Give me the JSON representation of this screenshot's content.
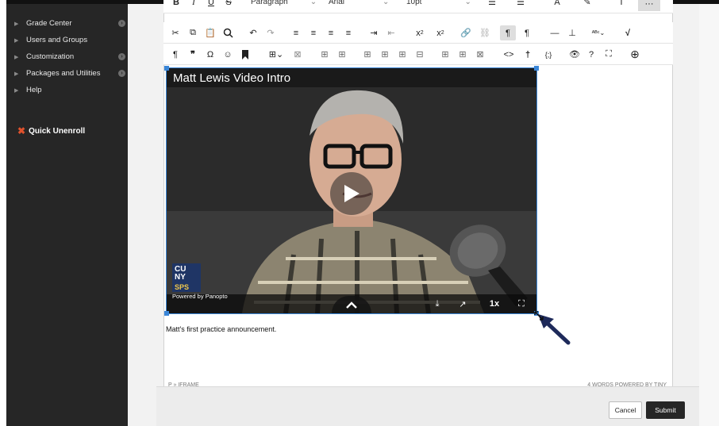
{
  "sidebar": {
    "items": [
      {
        "label": "Grade Center",
        "has_dot": true
      },
      {
        "label": "Users and Groups",
        "has_dot": false
      },
      {
        "label": "Customization",
        "has_dot": true
      },
      {
        "label": "Packages and Utilities",
        "has_dot": true
      },
      {
        "label": "Help",
        "has_dot": false
      }
    ],
    "quick_unenroll": "Quick Unenroll"
  },
  "toolbar": {
    "block_format": "Paragraph",
    "font_family": "Arial",
    "font_size": "10pt"
  },
  "video": {
    "title": "Matt Lewis Video Intro",
    "logo_lines": [
      "CU",
      "NY",
      "SPS"
    ],
    "powered_by": "Powered by Panopto",
    "speed": "1x"
  },
  "editor": {
    "body_text": "Matt's first practice announcement.",
    "path": "P » IFRAME",
    "word_count": "4 WORDS  POWERED BY TINY"
  },
  "footer": {
    "cancel_label": "Cancel",
    "submit_label": "Submit"
  },
  "colors": {
    "sidebar_bg": "#262626",
    "selection_blue": "#3a86d8",
    "arrow_navy": "#1e2a5a",
    "submit_bg": "#262626",
    "logo_bg": "#1f3565"
  }
}
